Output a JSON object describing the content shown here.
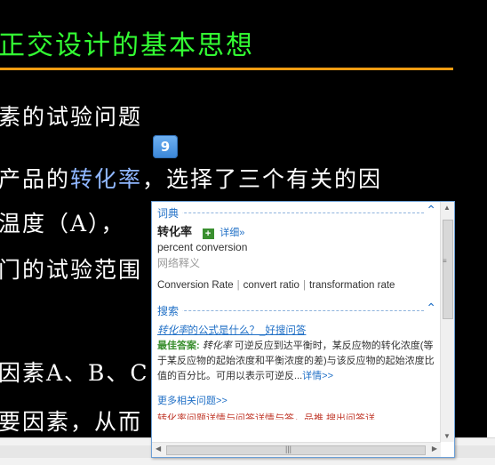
{
  "slide": {
    "title": "正交设计的基本思想",
    "lines": [
      {
        "text": "素的试验问题"
      },
      {
        "before": "产品的",
        "highlight": "转化率",
        "after": "，选择了三个有关的因"
      },
      {
        "text": "温度（A），"
      },
      {
        "text": "门的试验范围"
      },
      {
        "text": "因素A、B、C"
      },
      {
        "text": "要因素，从而"
      }
    ]
  },
  "trigger": {
    "label": "9"
  },
  "popup": {
    "dict": {
      "header": "词典",
      "word": "转化率",
      "add_icon": "+",
      "detail": "详细»",
      "definition": "percent conversion",
      "web_label": "网络释义",
      "terms": [
        "Conversion Rate",
        "convert ratio",
        "transformation rate"
      ],
      "separator": "|"
    },
    "search": {
      "header": "搜索",
      "q_word": "转化率",
      "q_rest": "的公式是什么？_好搜问答",
      "best_label": "最佳答案:",
      "best_word": "转化率",
      "best_text": "可逆反应到达平衡时，某反应物的转化浓度(等于某反应物的起始浓度和平衡浓度的差)与该反应物的起始浓度比值的百分比。可用以表示可逆反...",
      "detail_link": "详情>>",
      "more": "更多相关问题>>",
      "cut_text": "转化率问题详情与问答详情与答，品推 搜出问答详"
    },
    "colors": {
      "accent": "#1f6fc6",
      "green": "#3a8f2f"
    }
  }
}
